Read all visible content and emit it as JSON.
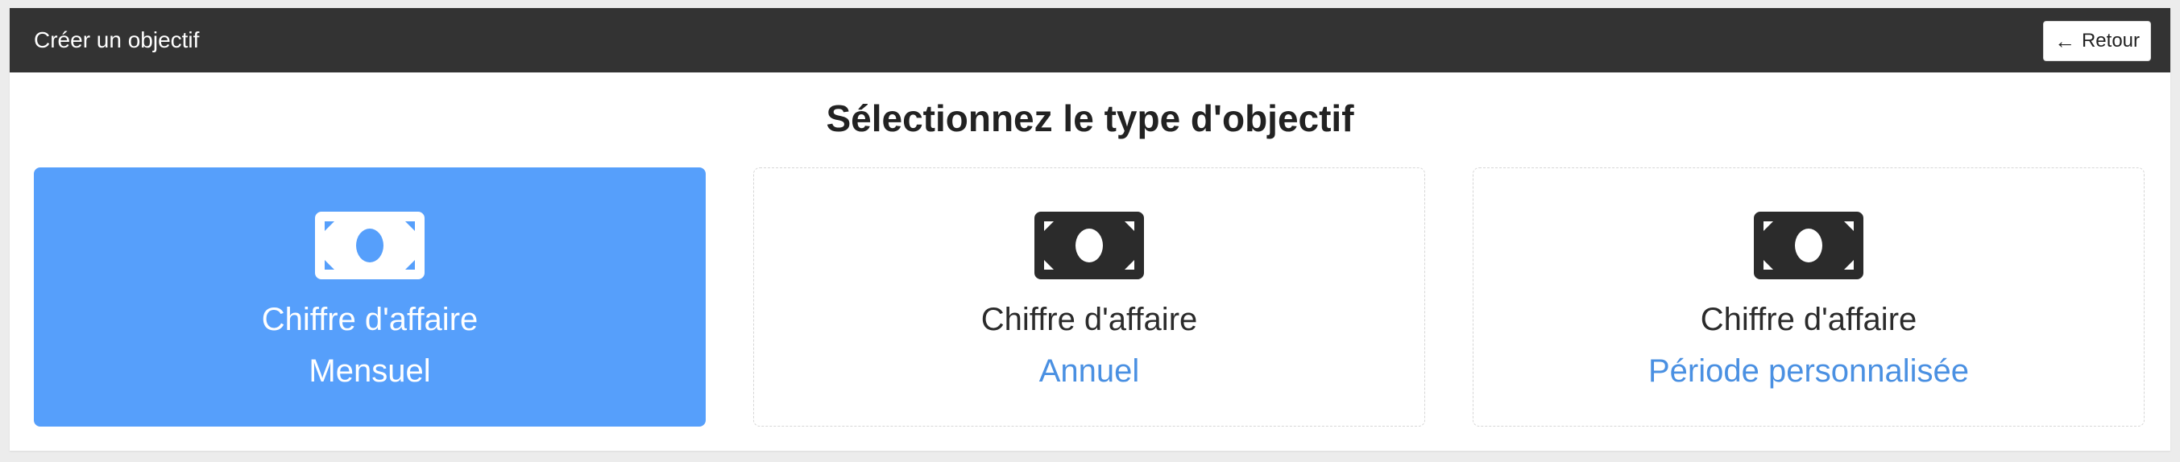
{
  "header": {
    "title": "Créer un objectif",
    "back_label": "Retour",
    "back_icon": "arrow-left-icon"
  },
  "main": {
    "title": "Sélectionnez le type d'objectif",
    "cards": [
      {
        "label": "Chiffre d'affaire",
        "sublabel": "Mensuel",
        "icon": "money-bill-icon",
        "selected": true
      },
      {
        "label": "Chiffre d'affaire",
        "sublabel": "Annuel",
        "icon": "money-bill-icon",
        "selected": false
      },
      {
        "label": "Chiffre d'affaire",
        "sublabel": "Période personnalisée",
        "icon": "money-bill-icon",
        "selected": false
      }
    ]
  },
  "colors": {
    "header_bg": "#333333",
    "selected_card_bg": "#569ffb",
    "accent_text": "#4a90e2",
    "icon_dark": "#2b2b2b",
    "icon_light": "#ffffff"
  }
}
